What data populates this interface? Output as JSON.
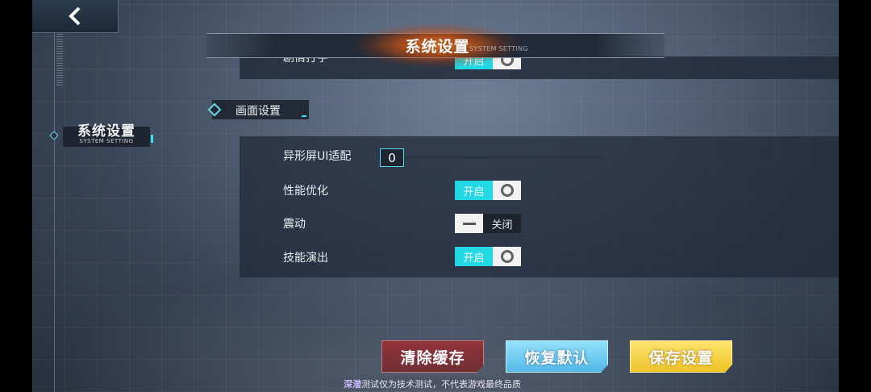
{
  "header": {
    "title": "系统设置",
    "subtitle": "SYSTEM SETTING"
  },
  "sidebar": {
    "tab_title": "系统设置",
    "tab_subtitle": "SYSTEM SETTING"
  },
  "top_row": {
    "label": "剧情打字",
    "toggle_label": "开启",
    "state": "on"
  },
  "section": {
    "title": "画面设置",
    "notch_slider": {
      "label": "异形屏UI适配",
      "value": "0"
    },
    "rows": [
      {
        "label": "性能优化",
        "toggle_label": "开启",
        "state": "on"
      },
      {
        "label": "震动",
        "toggle_label": "关闭",
        "state": "off"
      },
      {
        "label": "技能演出",
        "toggle_label": "开启",
        "state": "on"
      }
    ]
  },
  "buttons": {
    "clear_cache": "清除缓存",
    "restore_default": "恢复默认",
    "save_settings": "保存设置"
  },
  "footer": {
    "brand": "深潜",
    "text": "测试仅为技术测试，不代表游戏最终品质"
  },
  "colors": {
    "accent": "#22d8e4",
    "clear": "#8a1f24",
    "reset": "#3fb3e8",
    "save": "#f2c21a"
  }
}
